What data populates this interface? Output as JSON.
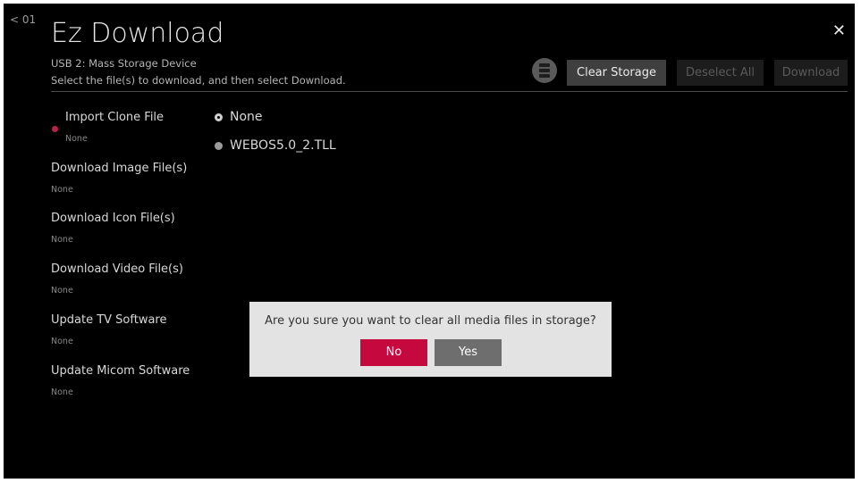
{
  "header": {
    "back_label": "< 01",
    "title": "Ez Download",
    "close_label": "✕",
    "device": "USB 2: Mass Storage Device",
    "instruction": "Select the file(s) to download, and then select Download."
  },
  "toolbar": {
    "storage_icon": "storage-icon",
    "clear_storage": "Clear Storage",
    "deselect_all": "Deselect All",
    "download": "Download"
  },
  "menu": [
    {
      "label": "Import Clone File",
      "value": "None",
      "active": true
    },
    {
      "label": "Download Image File(s)",
      "value": "None"
    },
    {
      "label": "Download Icon File(s)",
      "value": "None"
    },
    {
      "label": "Download Video File(s)",
      "value": "None"
    },
    {
      "label": "Update TV Software",
      "value": "None"
    },
    {
      "label": "Update Micom Software",
      "value": "None"
    }
  ],
  "options": [
    {
      "label": "None",
      "selected": true
    },
    {
      "label": "WEBOS5.0_2.TLL",
      "selected": false
    }
  ],
  "dialog": {
    "message": "Are you sure you want to clear all media files in storage?",
    "no_label": "No",
    "yes_label": "Yes"
  },
  "colors": {
    "accent": "#c5083d",
    "background": "#000000",
    "dialog_bg": "#e3e3e3"
  }
}
